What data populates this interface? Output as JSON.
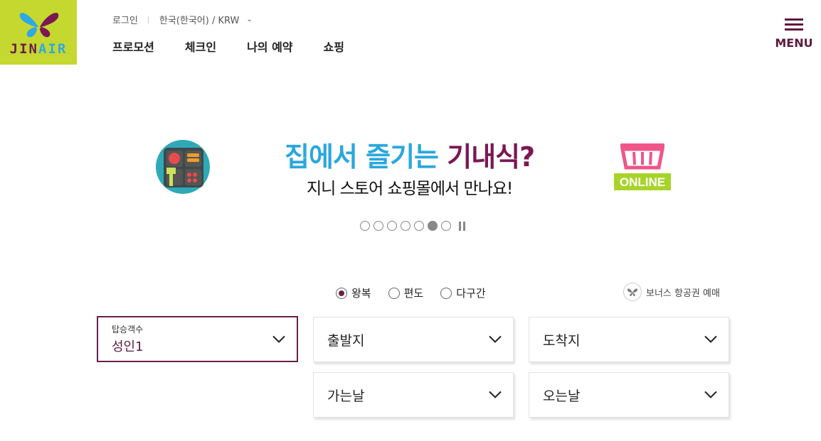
{
  "header": {
    "logo_text_a": "JIN",
    "logo_text_b": "AIR",
    "login": "로그인",
    "locale": "한국(한국어) / KRW",
    "nav": [
      "프로모션",
      "체크인",
      "나의 예약",
      "쇼핑"
    ],
    "menu_label": "MENU"
  },
  "banner": {
    "title_a": "집에서 즐기는 ",
    "title_b": "기내식?",
    "subtitle": "지니 스토어 쇼핑몰에서 만나요!",
    "online_badge": "ONLINE",
    "slide_count": 7,
    "active_slide": 6
  },
  "booking": {
    "trip_types": [
      "왕복",
      "편도",
      "다구간"
    ],
    "selected_trip": "왕복",
    "bonus_label": "보너스 항공권 예매",
    "passenger_caption": "탑승객수",
    "passenger_value": "성인1",
    "departure": "출발지",
    "arrival": "도착지",
    "depart_date": "가는날",
    "return_date": "오는날"
  },
  "colors": {
    "brand_green": "#c5d82f",
    "brand_purple": "#6b1e4a",
    "brand_blue": "#2fa9e3",
    "online_green": "#a8d42a",
    "basket_pink": "#f0558a"
  }
}
